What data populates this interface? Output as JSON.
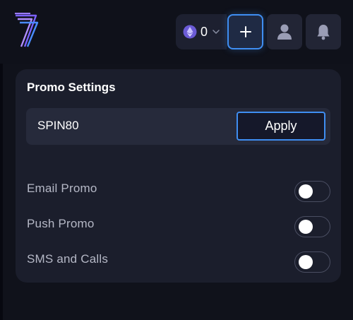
{
  "header": {
    "logo_icon": "seven-logo-icon",
    "wallet": {
      "currency_icon": "ethereum-icon",
      "amount": "0",
      "dropdown_icon": "chevron-down-icon"
    },
    "add_button": {
      "label": "+"
    },
    "profile_icon": "user-icon",
    "notifications_icon": "bell-icon"
  },
  "promo_settings": {
    "title": "Promo Settings",
    "promo_code": "SPIN80",
    "apply_label": "Apply",
    "toggles": [
      {
        "label": "Email Promo",
        "enabled": false
      },
      {
        "label": "Push Promo",
        "enabled": false
      },
      {
        "label": "SMS and Calls",
        "enabled": false
      }
    ]
  },
  "colors": {
    "accent_blue": "#3f8ef2",
    "card_bg": "#1b1e2c",
    "page_bg": "#10121b",
    "logo_purple": "#8f6cff"
  }
}
